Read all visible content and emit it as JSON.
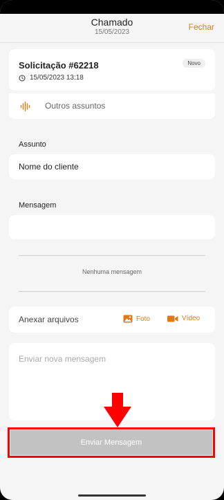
{
  "header": {
    "title": "Chamado",
    "subtitle": "15/05/2023",
    "close_label": "Fechar"
  },
  "ticket": {
    "title": "Solicitação #62218",
    "datetime": "15/05/2023 13:18",
    "status": "Novo"
  },
  "subject_type": {
    "label": "Outros assuntos",
    "icon": "audio-wave-icon"
  },
  "subject": {
    "label": "Assunto",
    "value": "Nome do cliente"
  },
  "message": {
    "label": "Mensagem",
    "value": "",
    "empty_text": "Nenhuma mensagem"
  },
  "attachments": {
    "label": "Anexar arquivos",
    "photo_label": "Foto",
    "video_label": "Vídeo"
  },
  "compose": {
    "placeholder": "Enviar nova mensagem"
  },
  "send_button": {
    "label": "Enviar Mensagem"
  },
  "colors": {
    "accent": "#e07b1a",
    "highlight": "#ff0000",
    "button_disabled": "#c2c2c2",
    "background": "#f5f5f5"
  }
}
